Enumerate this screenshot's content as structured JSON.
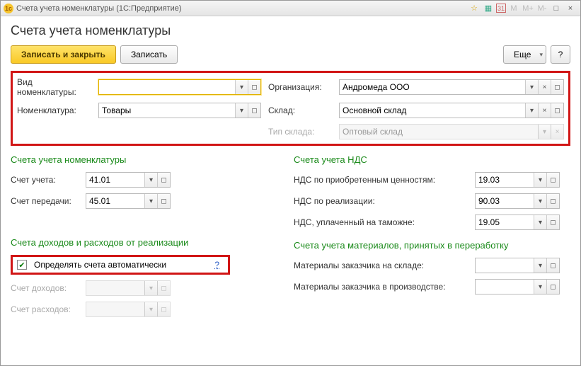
{
  "window": {
    "app_icon": "1c",
    "title": "Счета учета номенклатуры  (1С:Предприятие)"
  },
  "header": "Счета учета номенклатуры",
  "toolbar": {
    "save_close": "Записать и закрыть",
    "save": "Записать",
    "more": "Еще",
    "help": "?"
  },
  "top": {
    "type_label": "Вид номенклатуры:",
    "type_value": "",
    "org_label": "Организация:",
    "org_value": "Андромеда ООО",
    "nomen_label": "Номенклатура:",
    "nomen_value": "Товары",
    "wh_label": "Склад:",
    "wh_value": "Основной склад",
    "wh_type_label": "Тип склада:",
    "wh_type_value": "Оптовый склад"
  },
  "accts_section": "Счета учета номенклатуры",
  "accts": {
    "acct_label": "Счет учета:",
    "acct_value": "41.01",
    "transfer_label": "Счет передачи:",
    "transfer_value": "45.01"
  },
  "vat_section": "Счета учета НДС",
  "vat": {
    "purch_label": "НДС по приобретенным ценностям:",
    "purch_value": "19.03",
    "sales_label": "НДС по реализации:",
    "sales_value": "90.03",
    "customs_label": "НДС, уплаченный на таможне:",
    "customs_value": "19.05"
  },
  "pnl_section": "Счета доходов и расходов от реализации",
  "pnl": {
    "auto_label": "Определять счета автоматически",
    "auto_help": "?",
    "income_label": "Счет доходов:",
    "expense_label": "Счет расходов:"
  },
  "mat_section": "Счета учета материалов, принятых в переработку",
  "mat": {
    "stock_label": "Материалы заказчика на складе:",
    "prod_label": "Материалы заказчика в производстве:"
  },
  "glyph": {
    "drop": "▾",
    "open": "◻",
    "clear": "×",
    "check": "✔",
    "star": "☆",
    "calc": "▦",
    "cal": "31",
    "min": "—",
    "max": "□",
    "close": "×",
    "m": "M"
  }
}
